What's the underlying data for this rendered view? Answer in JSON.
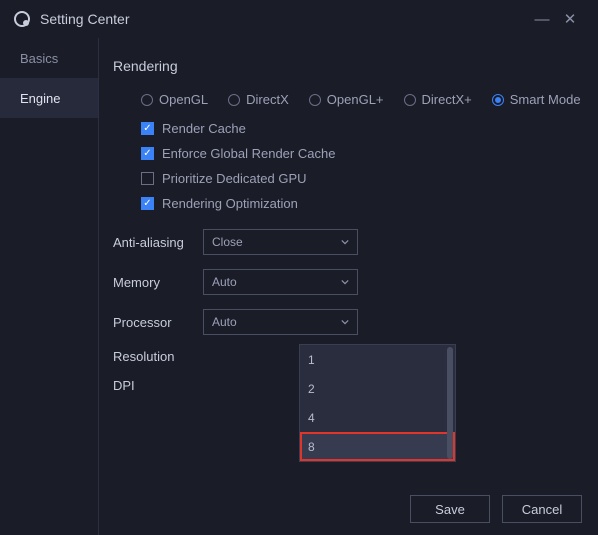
{
  "window": {
    "title": "Setting Center",
    "minimize": "—",
    "close": "✕"
  },
  "sidebar": {
    "items": [
      {
        "label": "Basics",
        "active": false
      },
      {
        "label": "Engine",
        "active": true
      }
    ]
  },
  "rendering": {
    "title": "Rendering",
    "modes": [
      {
        "label": "OpenGL",
        "selected": false
      },
      {
        "label": "DirectX",
        "selected": false
      },
      {
        "label": "OpenGL+",
        "selected": false
      },
      {
        "label": "DirectX+",
        "selected": false
      },
      {
        "label": "Smart Mode",
        "selected": true
      }
    ],
    "checks": [
      {
        "label": "Render Cache",
        "checked": true
      },
      {
        "label": "Enforce Global Render Cache",
        "checked": true
      },
      {
        "label": "Prioritize Dedicated GPU",
        "checked": false
      },
      {
        "label": "Rendering Optimization",
        "checked": true
      }
    ]
  },
  "settings": {
    "anti_aliasing": {
      "label": "Anti-aliasing",
      "value": "Close"
    },
    "memory": {
      "label": "Memory",
      "value": "Auto"
    },
    "processor": {
      "label": "Processor",
      "value": "Auto",
      "options": [
        "1",
        "2",
        "4",
        "8"
      ],
      "highlighted": "8"
    },
    "resolution": {
      "label": "Resolution"
    },
    "dpi": {
      "label": "DPI"
    }
  },
  "footer": {
    "save": "Save",
    "cancel": "Cancel"
  }
}
